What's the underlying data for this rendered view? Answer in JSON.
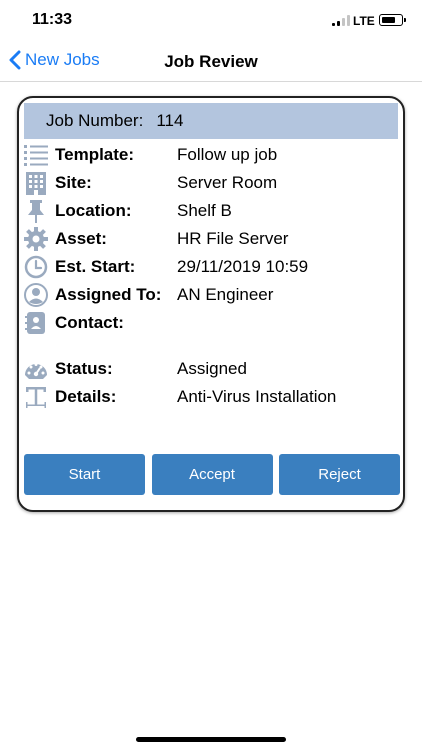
{
  "status_bar": {
    "time": "11:33",
    "network": "LTE"
  },
  "nav": {
    "back_label": "New Jobs",
    "title": "Job Review"
  },
  "job": {
    "number_label": "Job Number:",
    "number_value": "114",
    "fields": [
      {
        "icon": "list-icon",
        "label": "Template:",
        "value": "Follow up job"
      },
      {
        "icon": "building-icon",
        "label": "Site:",
        "value": "Server Room"
      },
      {
        "icon": "pin-icon",
        "label": "Location:",
        "value": "Shelf B"
      },
      {
        "icon": "gear-icon",
        "label": "Asset:",
        "value": "HR File Server"
      },
      {
        "icon": "clock-icon",
        "label": "Est. Start:",
        "value": "29/11/2019 10:59"
      },
      {
        "icon": "user-icon",
        "label": "Assigned To:",
        "value": "AN Engineer"
      },
      {
        "icon": "contact-book-icon",
        "label": "Contact:",
        "value": ""
      },
      {
        "icon": "gauge-icon",
        "label": "Status:",
        "value": "Assigned"
      },
      {
        "icon": "text-icon",
        "label": "Details:",
        "value": "Anti-Virus Installation"
      }
    ]
  },
  "actions": {
    "start": "Start",
    "accept": "Accept",
    "reject": "Reject"
  },
  "colors": {
    "accent": "#1a7cf5",
    "header_bg": "#b3c5de",
    "button_bg": "#3a7fbf",
    "icon": "#9aaabf"
  }
}
